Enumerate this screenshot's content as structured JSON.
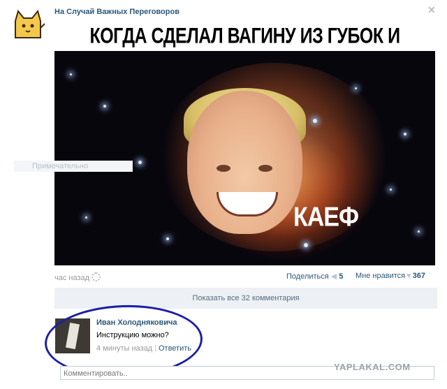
{
  "post": {
    "group_name": "На Случай Важных Переговоров",
    "close_glyph": "✕",
    "meme_caption": "КОГДА СДЕЛАЛ ВАГИНУ ИЗ ГУБОК И ПЕРЧАТКИ",
    "meme_overlay_text": "КАЕФ",
    "ghost_label": "Примечательно",
    "time": "час назад",
    "share_label": "Поделиться",
    "share_count": "5",
    "like_label": "Мне нравится",
    "like_count": "367",
    "show_all_comments": "Показать все 32 комментария"
  },
  "comment": {
    "author": "Иван Холодняковича",
    "text": "Инструкцию можно?",
    "time": "4 минуты назад",
    "separator": "|",
    "reply_label": "Ответить"
  },
  "composer": {
    "placeholder": "Комментировать.."
  },
  "watermark": "YAPLAKAL.COM",
  "icons": {
    "avatar": "cat-avatar-icon",
    "settings": "gear-icon",
    "share": "megaphone-icon",
    "like": "heart-icon"
  },
  "colors": {
    "link": "#2b587a",
    "muted": "#999999",
    "show_all_bg": "#edf1f5",
    "annotation_circle": "#1c1ea8"
  }
}
